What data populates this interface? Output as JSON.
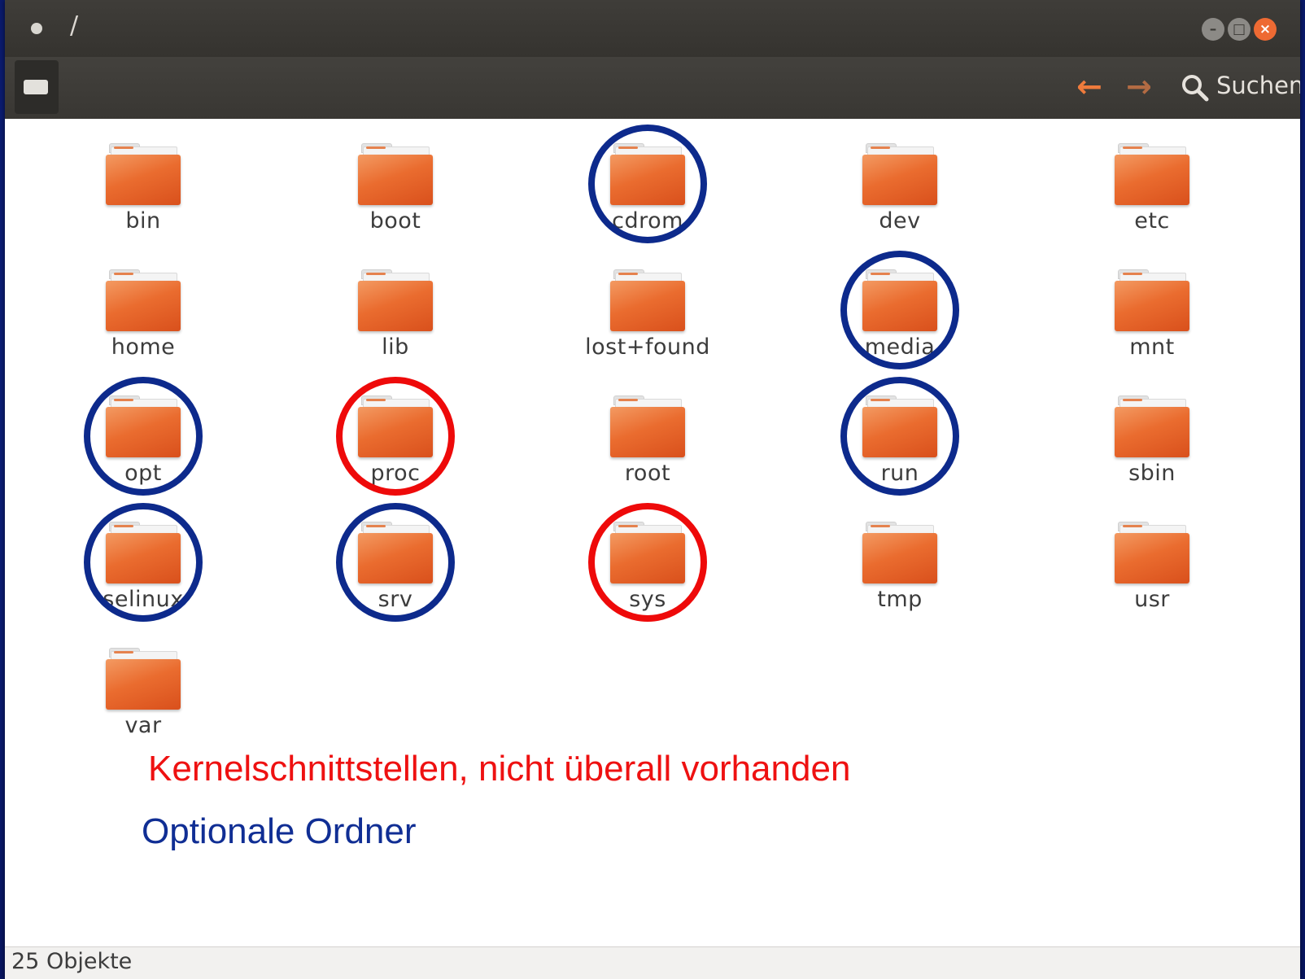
{
  "window": {
    "title": "/",
    "minimize_icon": "minimize-icon",
    "maximize_icon": "maximize-icon",
    "close_icon": "close-icon",
    "close_color": "#ee6a33"
  },
  "toolbar": {
    "drive_icon": "drive-icon",
    "back_icon": "arrow-left-icon",
    "forward_icon": "arrow-right-icon",
    "search_icon": "search-icon",
    "search_label": "Suchen",
    "accent": "#ef7b3c"
  },
  "folders": [
    {
      "name": "bin"
    },
    {
      "name": "boot"
    },
    {
      "name": "cdrom"
    },
    {
      "name": "dev"
    },
    {
      "name": "etc"
    },
    {
      "name": "home"
    },
    {
      "name": "lib"
    },
    {
      "name": "lost+found"
    },
    {
      "name": "media"
    },
    {
      "name": "mnt"
    },
    {
      "name": "opt"
    },
    {
      "name": "proc"
    },
    {
      "name": "root"
    },
    {
      "name": "run"
    },
    {
      "name": "sbin"
    },
    {
      "name": "selinux"
    },
    {
      "name": "srv"
    },
    {
      "name": "sys"
    },
    {
      "name": "tmp"
    },
    {
      "name": "usr"
    },
    {
      "name": "var"
    }
  ],
  "annotations": {
    "kernel_interfaces": [
      "proc",
      "sys"
    ],
    "optional_folders": [
      "cdrom",
      "media",
      "opt",
      "run",
      "selinux",
      "srv"
    ],
    "red_color": "#ee0a0a",
    "blue_color": "#0d2a8c"
  },
  "legend": {
    "red_text": "Kernelschnittstellen, nicht überall vorhanden",
    "blue_text": "Optionale Ordner"
  },
  "status": {
    "text": "25 Objekte"
  }
}
